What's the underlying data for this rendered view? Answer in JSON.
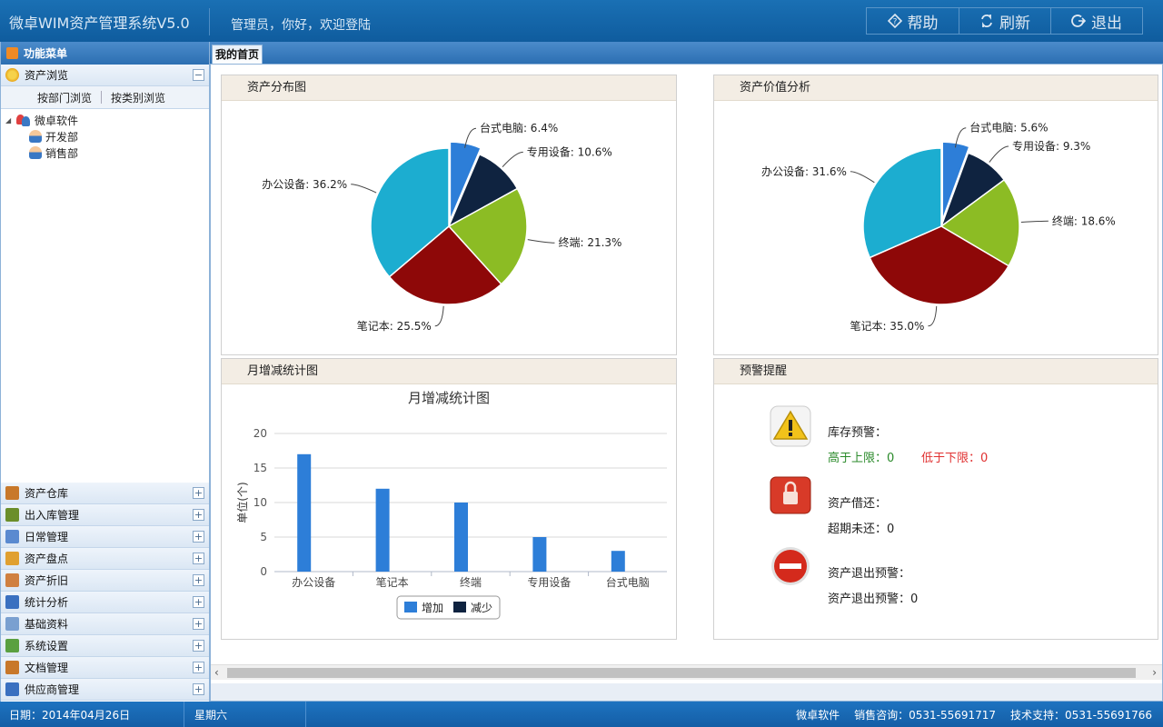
{
  "header": {
    "app_title": "微卓WIM资产管理系统V5.0",
    "welcome": "管理员，你好，欢迎登陆",
    "buttons": [
      {
        "label": "帮助",
        "icon": "help-icon"
      },
      {
        "label": "刷新",
        "icon": "refresh-icon"
      },
      {
        "label": "退出",
        "icon": "logout-icon"
      }
    ]
  },
  "sidebar": {
    "title": "功能菜单",
    "asset_browse": {
      "label": "资产浏览",
      "toggle": "−",
      "tabs": [
        "按部门浏览",
        "按类别浏览"
      ],
      "tree": {
        "root": "微卓软件",
        "children": [
          "开发部",
          "销售部"
        ]
      }
    },
    "items": [
      {
        "label": "资产仓库",
        "color": "#c8782a"
      },
      {
        "label": "出入库管理",
        "color": "#6b8e2a"
      },
      {
        "label": "日常管理",
        "color": "#5a8ad0"
      },
      {
        "label": "资产盘点",
        "color": "#e0a030"
      },
      {
        "label": "资产折旧",
        "color": "#d08040"
      },
      {
        "label": "统计分析",
        "color": "#3a70c0"
      },
      {
        "label": "基础资料",
        "color": "#7aa0d0"
      },
      {
        "label": "系统设置",
        "color": "#5aa040"
      },
      {
        "label": "文档管理",
        "color": "#c8782a"
      },
      {
        "label": "供应商管理",
        "color": "#3a70c0"
      }
    ],
    "toggle_plus": "+"
  },
  "tabs": {
    "home": "我的首页"
  },
  "panels": {
    "distribution": "资产分布图",
    "value": "资产价值分析",
    "monthly": "月增减统计图",
    "warning": "预警提醒"
  },
  "chart_data": [
    {
      "type": "pie",
      "slices": [
        {
          "label": "台式电脑",
          "value": 6.4,
          "color": "#2d7ed8"
        },
        {
          "label": "专用设备",
          "value": 10.6,
          "color": "#0f2340"
        },
        {
          "label": "终端",
          "value": 21.3,
          "color": "#8cbc24"
        },
        {
          "label": "笔记本",
          "value": 25.5,
          "color": "#8e0808"
        },
        {
          "label": "办公设备",
          "value": 36.2,
          "color": "#1cadd0"
        }
      ]
    },
    {
      "type": "pie",
      "slices": [
        {
          "label": "台式电脑",
          "value": 5.6,
          "color": "#2d7ed8"
        },
        {
          "label": "专用设备",
          "value": 9.3,
          "color": "#0f2340"
        },
        {
          "label": "终端",
          "value": 18.6,
          "color": "#8cbc24"
        },
        {
          "label": "笔记本",
          "value": 35.0,
          "color": "#8e0808"
        },
        {
          "label": "办公设备",
          "value": 31.6,
          "color": "#1cadd0"
        }
      ]
    },
    {
      "type": "bar",
      "title": "月增减统计图",
      "ylabel": "单位(个)",
      "categories": [
        "办公设备",
        "笔记本",
        "终端",
        "专用设备",
        "台式电脑"
      ],
      "series": [
        {
          "name": "增加",
          "values": [
            17,
            12,
            10,
            5,
            3
          ],
          "color": "#2d7ed8"
        },
        {
          "name": "减少",
          "values": [
            0,
            0,
            0,
            0,
            0
          ],
          "color": "#0f2340"
        }
      ],
      "ylim": [
        0,
        20
      ],
      "yticks": [
        0,
        5,
        10,
        15,
        20
      ],
      "grid": true,
      "legend": "bottom"
    }
  ],
  "warnings": {
    "stock_title": "库存预警：",
    "stock_high": "高于上限：0",
    "stock_low": "低于下限：0",
    "borrow_title": "资产借还：",
    "borrow_overdue": "超期未还：0",
    "exit_title": "资产退出预警：",
    "exit_count": "资产退出预警：0"
  },
  "statusbar": {
    "date": "日期：2014年04月26日",
    "weekday": "星期六",
    "company": "微卓软件",
    "sales": "销售咨询：0531-55691717",
    "support": "技术支持：0531-55691766"
  }
}
